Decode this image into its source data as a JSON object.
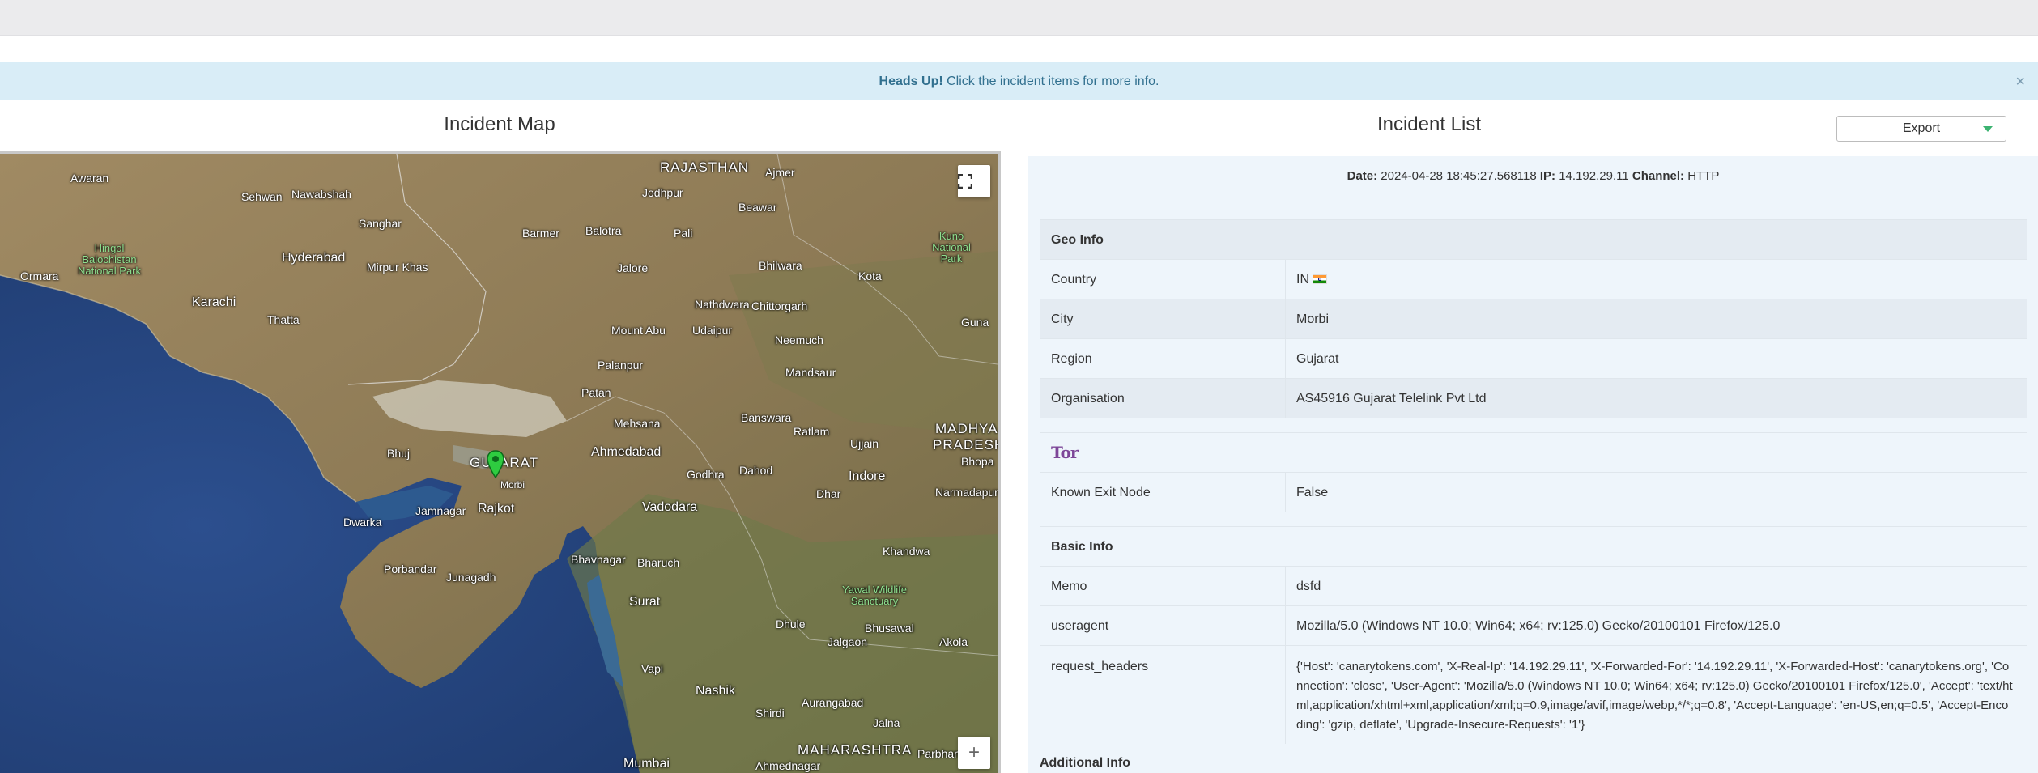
{
  "alert": {
    "strong": "Heads Up!",
    "text": " Click the incident items for more info.",
    "close": "×"
  },
  "map": {
    "title": "Incident Map",
    "fullscreen_icon": "fullscreen-icon",
    "zoom_in": "+",
    "labels": {
      "rajasthan": "RAJASTHAN",
      "gujarat": "GUJARAT",
      "madhya": "MADHYA",
      "pradesh": "PRADESH",
      "maharashtra": "MAHARASHTRA",
      "karachi": "Karachi",
      "hyderabad": "Hyderabad",
      "ahmedabad": "Ahmedabad",
      "vadodara": "Vadodara",
      "rajkot": "Rajkot",
      "surat": "Surat",
      "nashik": "Nashik",
      "mumbai": "Mumbai",
      "indore": "Indore",
      "jamnagar": "Jamnagar",
      "bhuj": "Bhuj",
      "morbi": "Morbi",
      "dwarka": "Dwarka",
      "porbandar": "Porbandar",
      "junagadh": "Junagadh",
      "bhavnagar": "Bhavnagar",
      "bharuch": "Bharuch",
      "udaipur": "Udaipur",
      "jodhpur": "Jodhpur",
      "barmer": "Barmer",
      "bhilwara": "Bhilwara",
      "kota": "Kota",
      "ujjain": "Ujjain",
      "ratlam": "Ratlam",
      "dahod": "Dahod",
      "godhra": "Godhra",
      "mehsana": "Mehsana",
      "palanpur": "Palanpur",
      "patan": "Patan",
      "hinglaj": "Hingol Balochistan National Park",
      "yawal": "Yawal Wildlife Sanctuary",
      "kuno": "Kuno National Park",
      "thatta": "Thatta",
      "ormara": "Ormara",
      "awaran": "Awaran",
      "sehwan": "Sehwan",
      "nawabshah": "Nawabshah",
      "sanghar": "Sanghar",
      "mirpurkhas": "Mirpur Khas",
      "balotra": "Balotra",
      "pali": "Pali",
      "ajmer": "Ajmer",
      "beawar": "Beawar",
      "jalore": "Jalore",
      "nathdwara": "Nathdwara",
      "chittorgarh": "Chittorgarh",
      "neemuch": "Neemuch",
      "mandsaur": "Mandsaur",
      "banswara": "Banswara",
      "dhar": "Dhar",
      "mountabu": "Mount Abu",
      "bhusawal": "Bhusawal",
      "jalgaon": "Jalgaon",
      "dhule": "Dhule",
      "akola": "Akola",
      "khandwa": "Khandwa",
      "aurangabad": "Aurangabad",
      "jalna": "Jalna",
      "shirdi": "Shirdi",
      "ahmednagar": "Ahmednagar",
      "parbhani": "Parbhani",
      "vapi": "Vapi",
      "guna": "Guna",
      "bhopal": "Bhopa",
      "narmadapuram": "Narmadapuram"
    }
  },
  "list": {
    "title": "Incident List",
    "export_label": "Export"
  },
  "incident": {
    "date_label": "Date:",
    "date": "2024-04-28 18:45:27.568118",
    "ip_label": "IP:",
    "ip": "14.192.29.11",
    "channel_label": "Channel:",
    "channel": "HTTP"
  },
  "geo": {
    "section": "Geo Info",
    "country_label": "Country",
    "country": "IN",
    "city_label": "City",
    "city": "Morbi",
    "region_label": "Region",
    "region": "Gujarat",
    "org_label": "Organisation",
    "org": "AS45916 Gujarat Telelink Pvt Ltd"
  },
  "tor": {
    "logo": "Tor",
    "exit_label": "Known Exit Node",
    "exit": "False"
  },
  "basic": {
    "section": "Basic Info",
    "memo_label": "Memo",
    "memo": "dsfd",
    "ua_label": "useragent",
    "ua": "Mozilla/5.0 (Windows NT 10.0; Win64; x64; rv:125.0) Gecko/20100101 Firefox/125.0",
    "headers_label": "request_headers",
    "headers": "{'Host': 'canarytokens.com', 'X-Real-Ip': '14.192.29.11', 'X-Forwarded-For': '14.192.29.11', 'X-Forwarded-Host': 'canarytokens.org', 'Connection': 'close', 'User-Agent': 'Mozilla/5.0 (Windows NT 10.0; Win64; x64; rv:125.0) Gecko/20100101 Firefox/125.0', 'Accept': 'text/html,application/xhtml+xml,application/xml;q=0.9,image/avif,image/webp,*/*;q=0.8', 'Accept-Language': 'en-US,en;q=0.5', 'Accept-Encoding': 'gzip, deflate', 'Upgrade-Insecure-Requests': '1'}"
  },
  "additional": {
    "section": "Additional Info"
  },
  "colors": {
    "alert_bg": "#d9edf7",
    "alert_text": "#31708f",
    "detail_bg": "#eef5fb",
    "marker": "#2ecc40",
    "tor_purple": "#7d4698"
  }
}
